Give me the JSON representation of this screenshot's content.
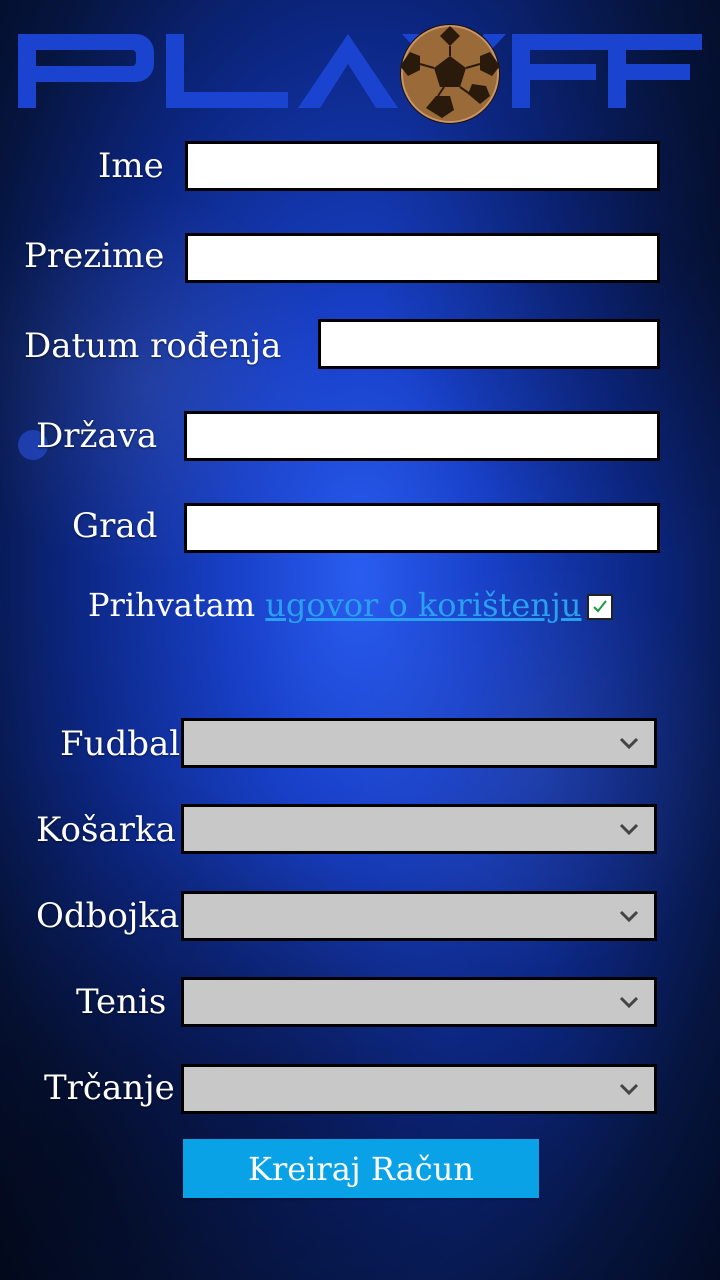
{
  "logo": {
    "text": "PLAY OFF"
  },
  "form": {
    "ime": {
      "label": "Ime",
      "value": ""
    },
    "prezime": {
      "label": "Prezime",
      "value": ""
    },
    "datum": {
      "label": "Datum rođenja",
      "value": ""
    },
    "drzava": {
      "label": "Država",
      "value": ""
    },
    "grad": {
      "label": "Grad",
      "value": ""
    }
  },
  "terms": {
    "prefix": "Prihvatam",
    "link": "ugovor o korištenju",
    "checked": true
  },
  "sports": [
    {
      "label": "Fudbal",
      "selected": ""
    },
    {
      "label": "Košarka",
      "selected": ""
    },
    {
      "label": "Odbojka",
      "selected": ""
    },
    {
      "label": "Tenis",
      "selected": ""
    },
    {
      "label": "Trčanje",
      "selected": ""
    }
  ],
  "submit_label": "Kreiraj Račun",
  "colors": {
    "brand": "#1a44d0",
    "button": "#0aa2e6",
    "link": "#29a0f0",
    "ball": "#8b5a2b"
  }
}
